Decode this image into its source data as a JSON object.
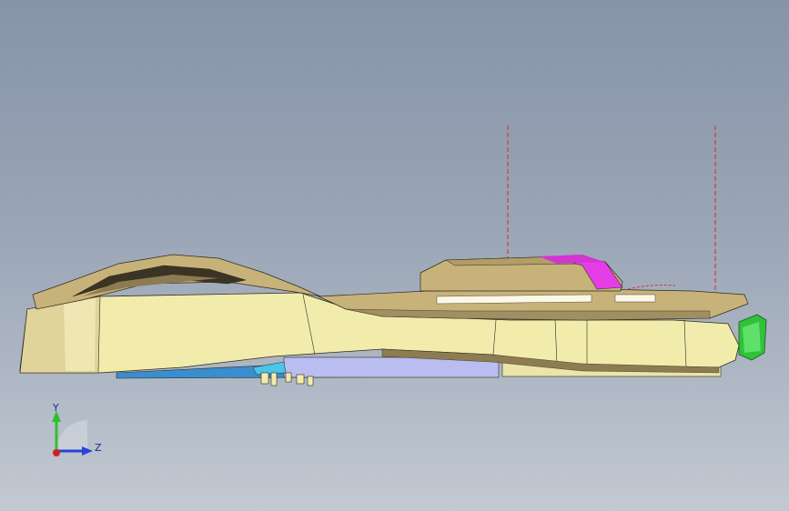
{
  "viewport": {
    "background_top": "#8794a8",
    "background_bottom": "#c3c9d2"
  },
  "model": {
    "body_color": "#f2ecac",
    "shade_color": "#d8c98a",
    "edge_color": "#2e2a1c",
    "top_surface_color": "#c7b27a",
    "highlight_part_color": "#e63ee6",
    "green_part_color": "#2fc23a",
    "blue_part_color": "#b9bdf0",
    "reference_line_color": "#d43a3a"
  },
  "triad": {
    "y_label": "Y",
    "z_label": "Z",
    "y_color": "#2fbf2f",
    "z_color": "#2a43d8",
    "x_color": "#d22020"
  }
}
